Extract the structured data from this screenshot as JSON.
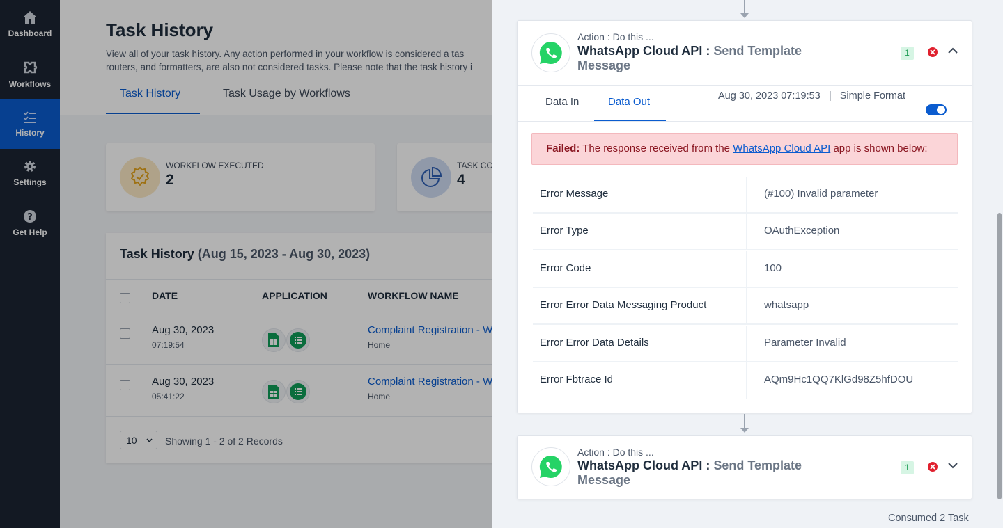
{
  "sidebar": {
    "items": [
      {
        "label": "Dashboard",
        "icon": "home-icon"
      },
      {
        "label": "Workflows",
        "icon": "workflow-icon"
      },
      {
        "label": "History",
        "icon": "history-icon",
        "active": true
      },
      {
        "label": "Settings",
        "icon": "gear-icon"
      },
      {
        "label": "Get Help",
        "icon": "help-icon"
      }
    ]
  },
  "page": {
    "title": "Task History",
    "description_line1": "View all of your task history. Any action performed in your workflow is considered a tas",
    "description_line2": "routers, and formatters, are also not considered tasks. Please note that the task history i",
    "tabs": [
      {
        "label": "Task History",
        "active": true
      },
      {
        "label": "Task Usage by Workflows",
        "active": false
      }
    ]
  },
  "stats": [
    {
      "label": "WORKFLOW EXECUTED",
      "value": "2"
    },
    {
      "label": "TASK CO",
      "value": "4"
    }
  ],
  "task_table": {
    "title": "Task History",
    "range": "(Aug 15, 2023 - Aug 30, 2023)",
    "columns": [
      "DATE",
      "APPLICATION",
      "WORKFLOW NAME"
    ],
    "rows": [
      {
        "date": "Aug 30, 2023",
        "time": "07:19:54",
        "workflow": "Complaint Registration - W",
        "sub": "Home"
      },
      {
        "date": "Aug 30, 2023",
        "time": "05:41:22",
        "workflow": "Complaint Registration - W",
        "sub": "Home"
      }
    ],
    "page_size": "10",
    "showing": "Showing 1 - 2 of 2 Records"
  },
  "panel": {
    "step1": {
      "action_label": "Action : Do this ...",
      "app": "WhatsApp Cloud API :",
      "event": "Send Template Message",
      "count": "1",
      "tabs": [
        "Data In",
        "Data Out"
      ],
      "active_tab": "Data Out",
      "timestamp": "Aug 30, 2023 07:19:53",
      "separator": "|",
      "format_label": "Simple Format",
      "alert_prefix": "Failed:",
      "alert_text1": "The response received from the",
      "alert_link": "WhatsApp Cloud API",
      "alert_text2": "app is shown below:",
      "errors": [
        {
          "key": "Error Message",
          "value": "(#100) Invalid parameter"
        },
        {
          "key": "Error Type",
          "value": "OAuthException"
        },
        {
          "key": "Error Code",
          "value": "100"
        },
        {
          "key": "Error Error Data Messaging Product",
          "value": "whatsapp"
        },
        {
          "key": "Error Error Data Details",
          "value": "Parameter Invalid"
        },
        {
          "key": "Error Fbtrace Id",
          "value": "AQm9Hc1QQ7KlGd98Z5hfDOU"
        }
      ]
    },
    "step2": {
      "action_label": "Action : Do this ...",
      "app": "WhatsApp Cloud API :",
      "event": "Send Template Message",
      "count": "1"
    },
    "consumed": "Consumed 2 Task"
  },
  "colors": {
    "sidebar_bg": "#1c2533",
    "active_blue": "#0b5ccf",
    "alert_bg": "#fbd5d8",
    "whatsapp_green": "#25d366",
    "error_red": "#e0202e"
  }
}
